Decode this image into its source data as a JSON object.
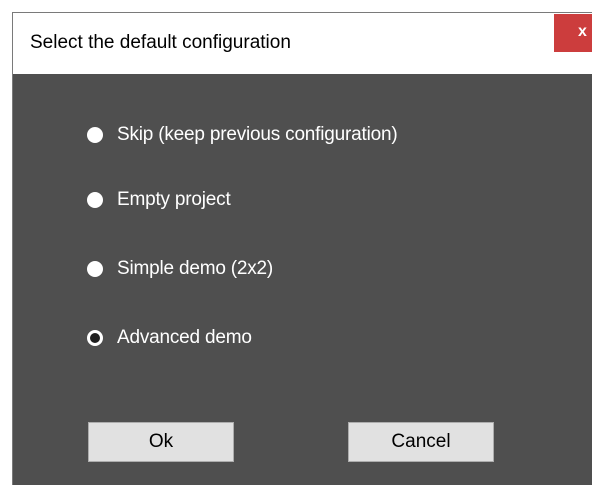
{
  "dialog": {
    "title": "Select the default configuration",
    "close_label": "x"
  },
  "options": [
    {
      "label": "Skip (keep previous configuration)",
      "selected": false
    },
    {
      "label": "Empty project",
      "selected": false
    },
    {
      "label": "Simple demo (2x2)",
      "selected": false
    },
    {
      "label": "Advanced demo",
      "selected": true
    }
  ],
  "buttons": {
    "ok_label": "Ok",
    "cancel_label": "Cancel"
  },
  "colors": {
    "panel_background": "#4f4f4f",
    "close_button": "#cc3d3d",
    "button_face": "#e1e1e1"
  }
}
